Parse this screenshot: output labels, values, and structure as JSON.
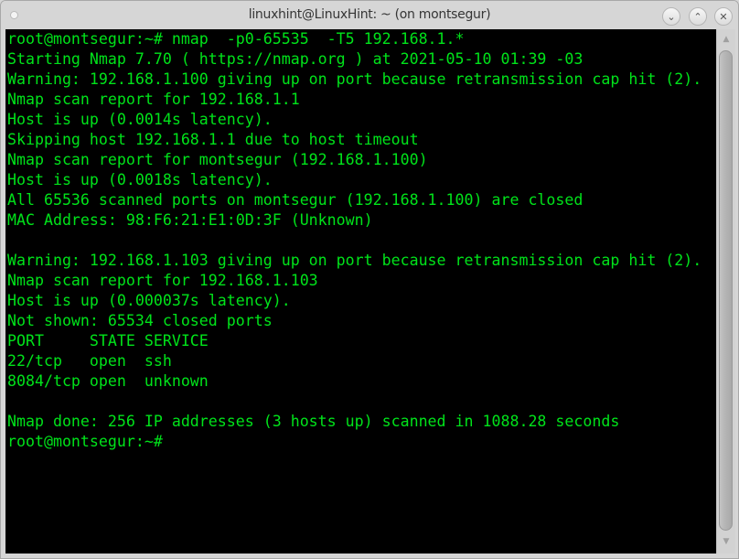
{
  "window": {
    "title": "linuxhint@LinuxHint: ~ (on montsegur)",
    "buttons": {
      "minimize_icon": "⌄",
      "maximize_icon": "⌃",
      "close_icon": "✕"
    }
  },
  "terminal": {
    "text_color": "#00e31a",
    "background_color": "#000000",
    "lines": [
      "root@montsegur:~# nmap  -p0-65535  -T5 192.168.1.*",
      "Starting Nmap 7.70 ( https://nmap.org ) at 2021-05-10 01:39 -03",
      "Warning: 192.168.1.100 giving up on port because retransmission cap hit (2).",
      "Nmap scan report for 192.168.1.1",
      "Host is up (0.0014s latency).",
      "Skipping host 192.168.1.1 due to host timeout",
      "Nmap scan report for montsegur (192.168.1.100)",
      "Host is up (0.0018s latency).",
      "All 65536 scanned ports on montsegur (192.168.1.100) are closed",
      "MAC Address: 98:F6:21:E1:0D:3F (Unknown)",
      "",
      "Warning: 192.168.1.103 giving up on port because retransmission cap hit (2).",
      "Nmap scan report for 192.168.1.103",
      "Host is up (0.000037s latency).",
      "Not shown: 65534 closed ports",
      "PORT     STATE SERVICE",
      "22/tcp   open  ssh",
      "8084/tcp open  unknown",
      "",
      "Nmap done: 256 IP addresses (3 hosts up) scanned in 1088.28 seconds",
      "root@montsegur:~# "
    ]
  },
  "scrollbar": {
    "up_icon": "▲",
    "down_icon": "▼"
  }
}
